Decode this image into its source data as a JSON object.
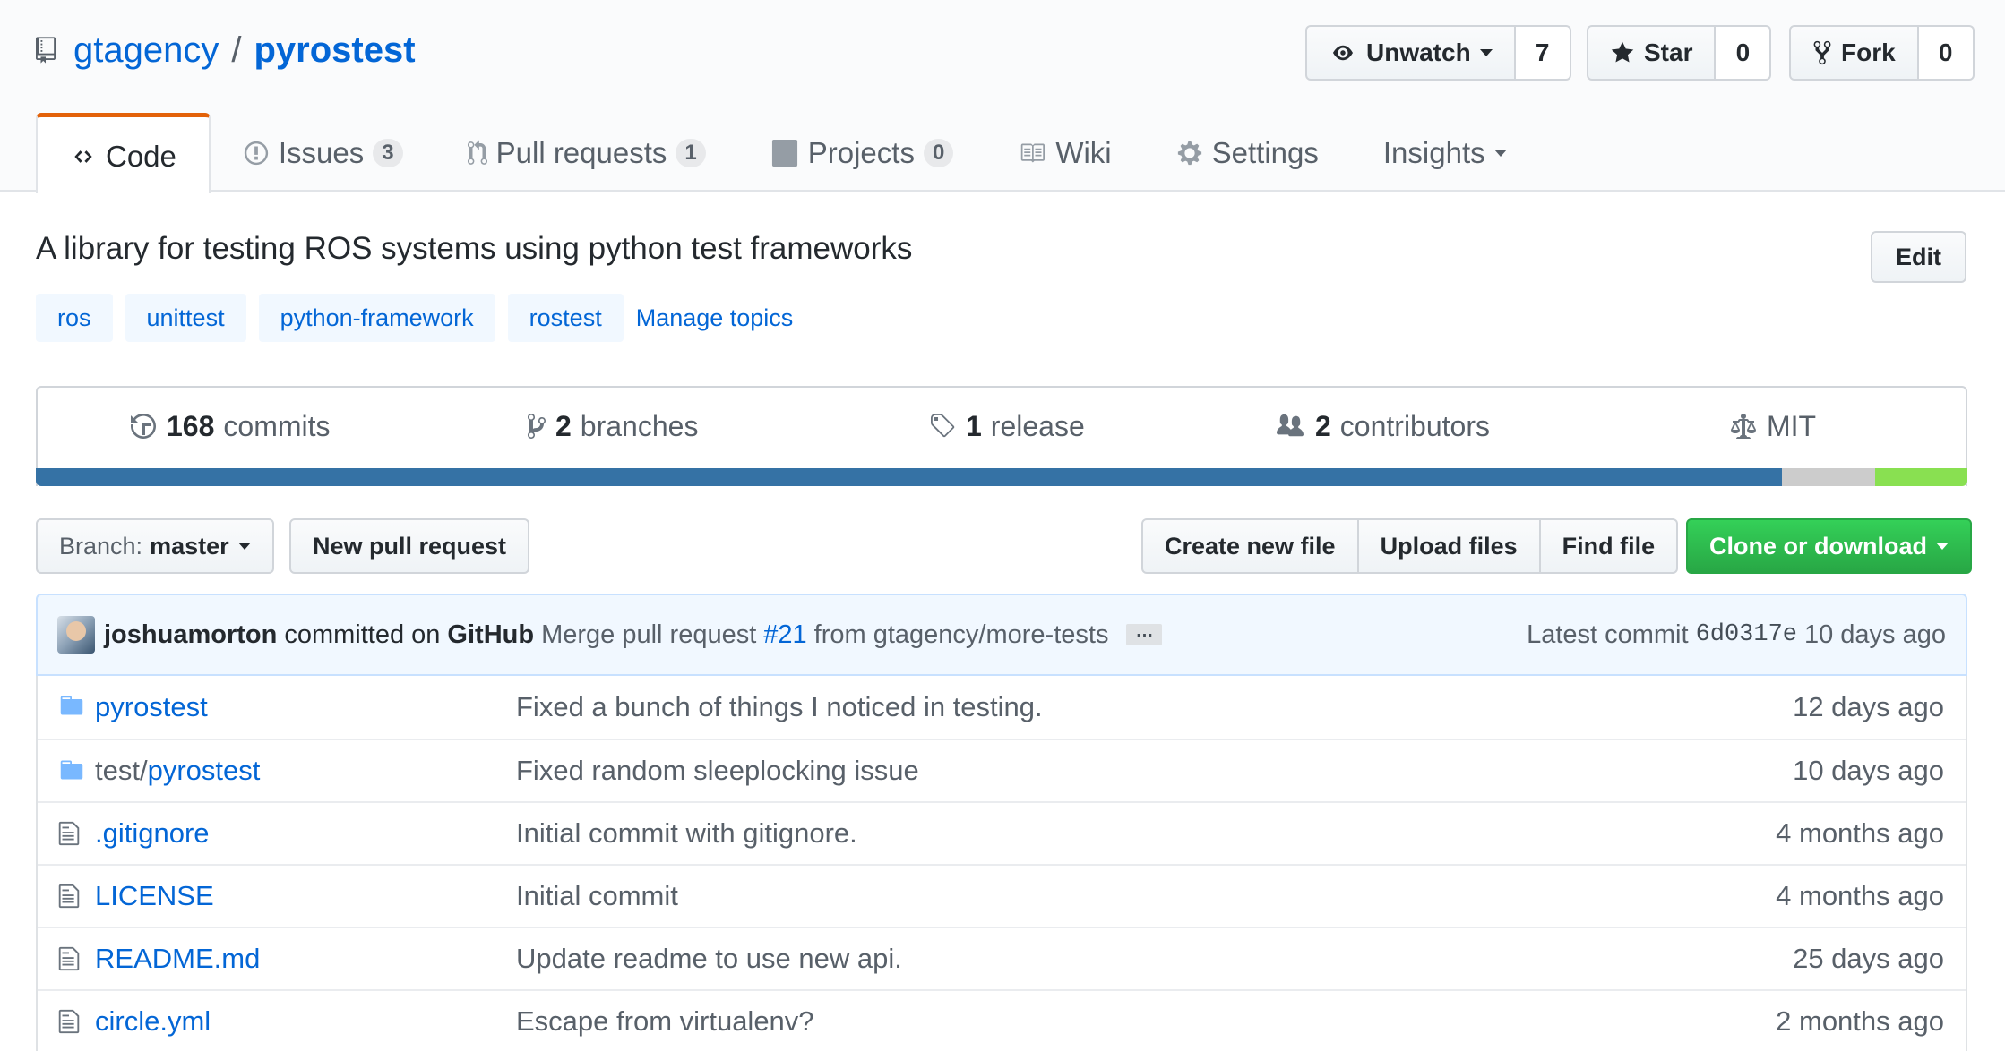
{
  "repo": {
    "owner": "gtagency",
    "separator": "/",
    "name": "pyrostest"
  },
  "actions": {
    "watch": {
      "label": "Unwatch",
      "count": "7"
    },
    "star": {
      "label": "Star",
      "count": "0"
    },
    "fork": {
      "label": "Fork",
      "count": "0"
    }
  },
  "tabs": [
    {
      "label": "Code",
      "active": true
    },
    {
      "label": "Issues",
      "count": "3"
    },
    {
      "label": "Pull requests",
      "count": "1"
    },
    {
      "label": "Projects",
      "count": "0"
    },
    {
      "label": "Wiki"
    },
    {
      "label": "Settings"
    },
    {
      "label": "Insights"
    }
  ],
  "description": "A library for testing ROS systems using python test frameworks",
  "edit_label": "Edit",
  "topics": [
    "ros",
    "unittest",
    "python-framework",
    "rostest"
  ],
  "manage_topics": "Manage topics",
  "summary": {
    "commits": {
      "num": "168",
      "label": "commits"
    },
    "branches": {
      "num": "2",
      "label": "branches"
    },
    "releases": {
      "num": "1",
      "label": "release"
    },
    "contributors": {
      "num": "2",
      "label": "contributors"
    },
    "license": "MIT"
  },
  "language_colors": [
    "#3572a5",
    "#cccccc",
    "#89e051"
  ],
  "language_fractions": [
    0.904,
    0.048,
    0.048
  ],
  "filenav": {
    "branch_prefix": "Branch:",
    "branch": "master",
    "new_pr": "New pull request",
    "create_file": "Create new file",
    "upload_files": "Upload files",
    "find_file": "Find file",
    "clone": "Clone or download"
  },
  "latest_commit": {
    "author": "joshuamorton",
    "committed_on": "committed on",
    "platform": "GitHub",
    "message_pre": "Merge pull request",
    "pr_link": "#21",
    "message_post": "from gtagency/more-tests",
    "ellipsis": "…",
    "latest_label": "Latest commit",
    "sha": "6d0317e",
    "age": "10 days ago"
  },
  "files": [
    {
      "type": "dir",
      "name": "pyrostest",
      "message": "Fixed a bunch of things I noticed in testing.",
      "age": "12 days ago"
    },
    {
      "type": "dir",
      "prefix": "test/",
      "name": "pyrostest",
      "message": "Fixed random sleeplocking issue",
      "age": "10 days ago"
    },
    {
      "type": "file",
      "name": ".gitignore",
      "message": "Initial commit with gitignore.",
      "age": "4 months ago"
    },
    {
      "type": "file",
      "name": "LICENSE",
      "message": "Initial commit",
      "age": "4 months ago"
    },
    {
      "type": "file",
      "name": "README.md",
      "message": "Update readme to use new api.",
      "age": "25 days ago"
    },
    {
      "type": "file",
      "name": "circle.yml",
      "message": "Escape from virtualenv?",
      "age": "2 months ago"
    }
  ]
}
